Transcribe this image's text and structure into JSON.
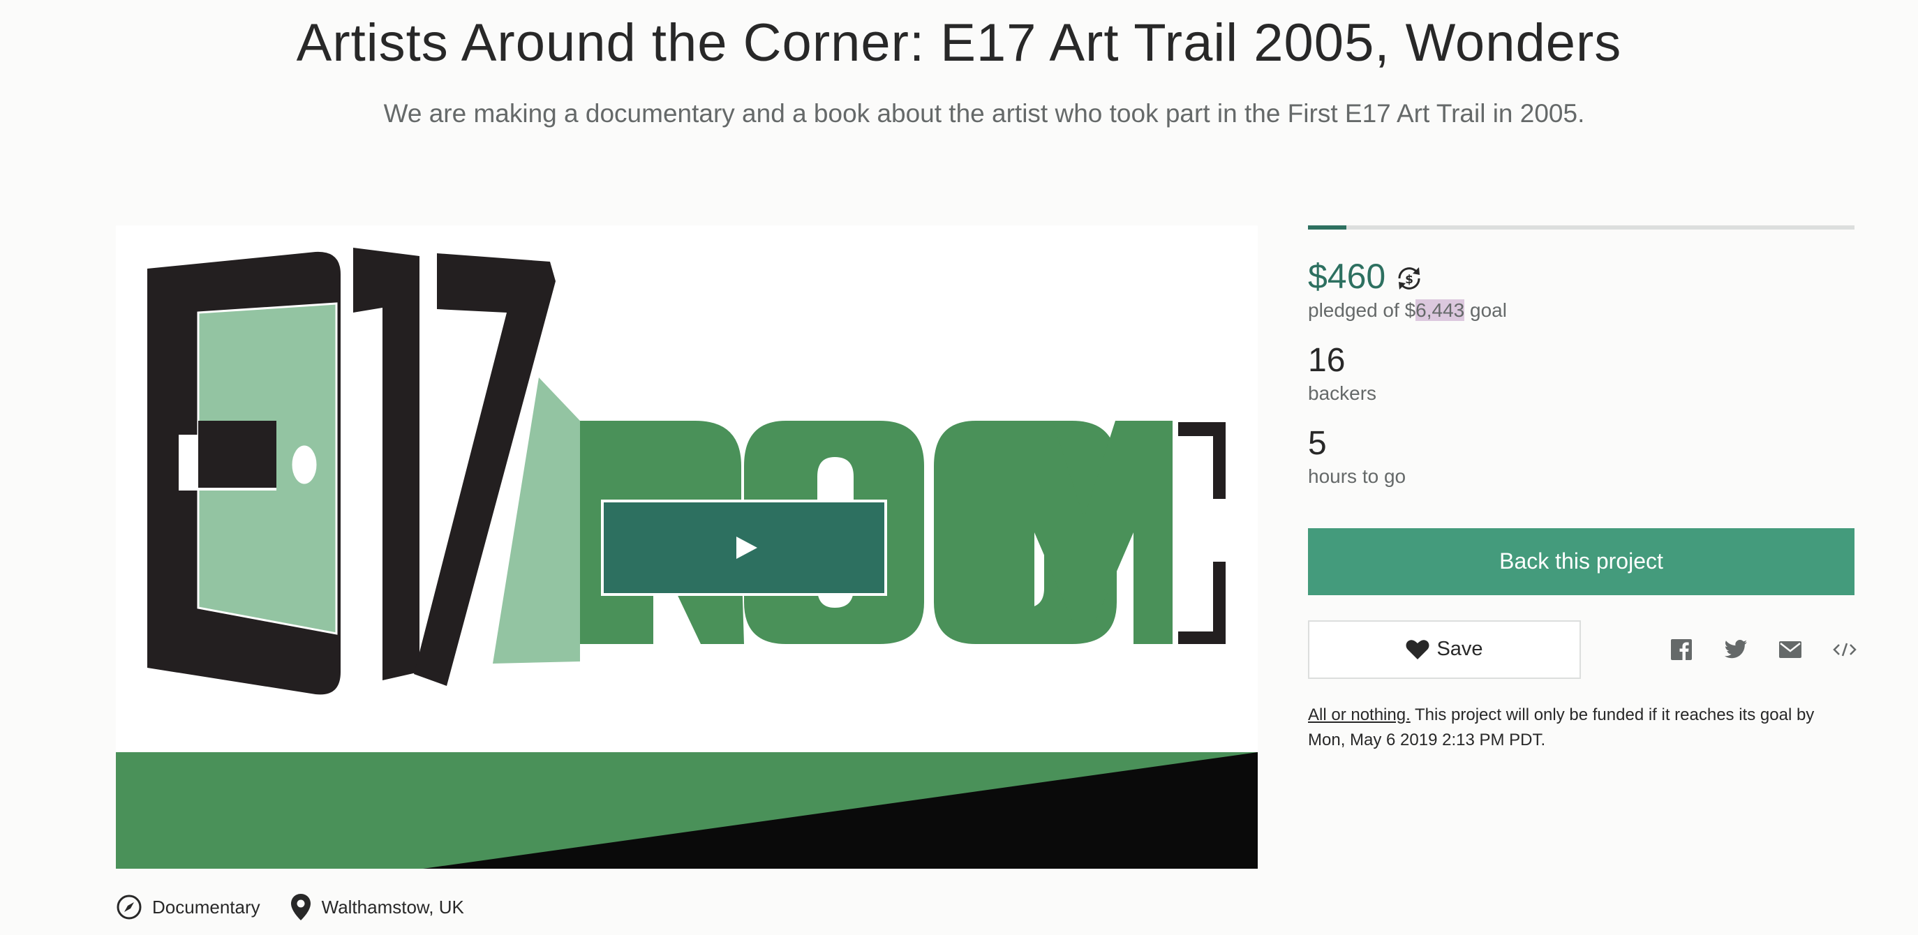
{
  "header": {
    "title": "Artists Around the Corner: E17 Art Trail 2005, Wonders",
    "subtitle": "We are making a documentary and a book about the artist who took part in the First E17 Art Trail in 2005."
  },
  "media": {
    "logo_text": "E17ROOM",
    "colors": {
      "dark": "#231f20",
      "light_green": "#93c4a2",
      "green": "#4a9159",
      "play_bg": "#2d7060"
    }
  },
  "meta": {
    "category": "Documentary",
    "location": "Walthamstow, UK",
    "category_icon": "compass-icon",
    "location_icon": "map-pin-icon"
  },
  "funding": {
    "pledged": "$460",
    "pledged_prefix": "pledged of $",
    "goal_amount": "6,443",
    "goal_suffix": " goal",
    "progress_percent": 7,
    "backers_count": "16",
    "backers_label": "backers",
    "time_count": "5",
    "time_label": "hours to go",
    "accent_color": "#2d7060",
    "button_color": "#449b7c"
  },
  "actions": {
    "back_label": "Back this project",
    "save_label": "Save",
    "share_icons": [
      "facebook-icon",
      "twitter-icon",
      "email-icon",
      "embed-icon"
    ]
  },
  "note": {
    "all_or_nothing": "All or nothing.",
    "text": " This project will only be funded if it reaches its goal by Mon, May 6 2019 2:13 PM PDT."
  }
}
